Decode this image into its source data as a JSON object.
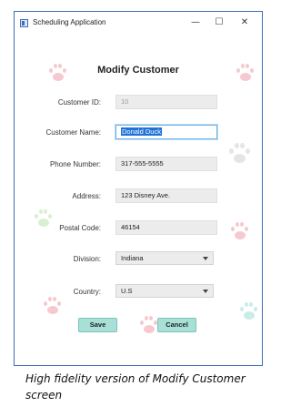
{
  "window": {
    "title": "Scheduling Application",
    "controls": {
      "minimize": "—",
      "maximize": "☐",
      "close": "✕"
    }
  },
  "form": {
    "heading": "Modify Customer",
    "fields": {
      "customer_id": {
        "label": "Customer ID:",
        "value": "10"
      },
      "customer_name": {
        "label": "Customer Name:",
        "value": "Donald Duck"
      },
      "phone": {
        "label": "Phone Number:",
        "value": "317-555-5555"
      },
      "address": {
        "label": "Address:",
        "value": "123 Disney Ave."
      },
      "postal_code": {
        "label": "Postal Code:",
        "value": "46154"
      },
      "division": {
        "label": "Division:",
        "value": "Indiana"
      },
      "country": {
        "label": "Country:",
        "value": "U.S"
      }
    },
    "buttons": {
      "save": "Save",
      "cancel": "Cancel"
    }
  },
  "caption": "High fidelity version of Modify Customer screen",
  "colors": {
    "window_border": "#3b6fb6",
    "field_bg": "#ececec",
    "button_bg": "#a8e0d8",
    "selection": "#1f72d6",
    "paw_pink": "#f5c9cf",
    "paw_teal": "#c9ece8",
    "paw_green": "#d9efd2",
    "paw_gray": "#e5e5e5"
  }
}
